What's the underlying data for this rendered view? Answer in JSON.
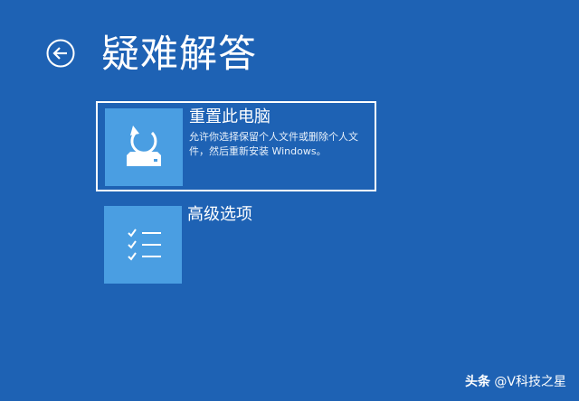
{
  "header": {
    "title": "疑难解答",
    "back_icon": "back-arrow-icon"
  },
  "options": [
    {
      "title": "重置此电脑",
      "description": "允许你选择保留个人文件或删除个人文件，然后重新安装 Windows。",
      "icon": "reset-pc-icon",
      "selected": true
    },
    {
      "title": "高级选项",
      "description": "",
      "icon": "checklist-icon",
      "selected": false
    }
  ],
  "watermark": {
    "brand": "头条",
    "account": "@V科技之星"
  },
  "colors": {
    "background": "#1e62b4",
    "tile": "#4a9ee2",
    "text": "#ffffff"
  }
}
